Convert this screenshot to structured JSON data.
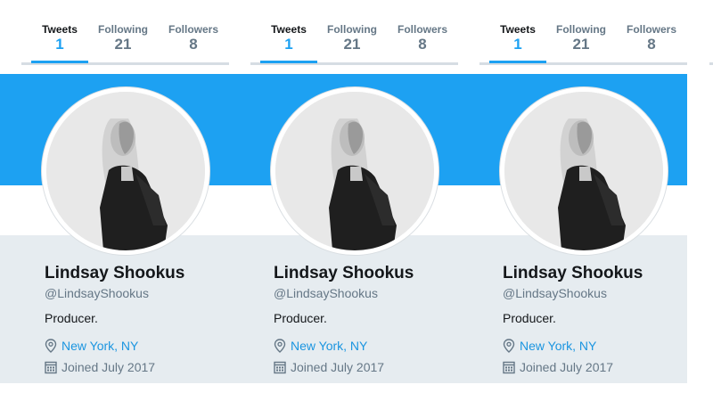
{
  "profiles": [
    {
      "tabs": [
        {
          "label": "Tweets",
          "count": "1"
        },
        {
          "label": "Following",
          "count": "21"
        },
        {
          "label": "Followers",
          "count": "8"
        }
      ],
      "name": "Lindsay Shookus",
      "handle": "@LindsayShookus",
      "bio": "Producer.",
      "location": "New York, NY",
      "joined": "Joined July 2017"
    },
    {
      "tabs": [
        {
          "label": "Tweets",
          "count": "1"
        },
        {
          "label": "Following",
          "count": "21"
        },
        {
          "label": "Followers",
          "count": "8"
        }
      ],
      "name": "Lindsay Shookus",
      "handle": "@LindsayShookus",
      "bio": "Producer.",
      "location": "New York, NY",
      "joined": "Joined July 2017"
    },
    {
      "tabs": [
        {
          "label": "Tweets",
          "count": "1"
        },
        {
          "label": "Following",
          "count": "21"
        },
        {
          "label": "Followers",
          "count": "8"
        }
      ],
      "name": "Lindsay Shookus",
      "handle": "@LindsayShookus",
      "bio": "Producer.",
      "location": "New York, NY",
      "joined": "Joined July 2017"
    }
  ],
  "icons": {
    "location": "map-pin-icon",
    "joined": "calendar-icon"
  },
  "colors": {
    "brand_blue": "#1da1f2",
    "link_blue": "#1b95e0",
    "background_gray": "#e6ecf0",
    "secondary_text": "#657786",
    "primary_text": "#14171a"
  }
}
